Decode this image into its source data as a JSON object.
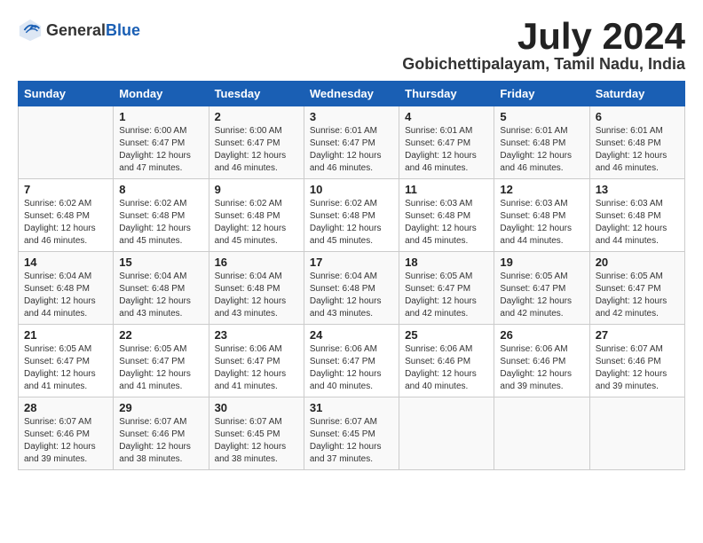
{
  "header": {
    "logo_general": "General",
    "logo_blue": "Blue",
    "month_title": "July 2024",
    "location": "Gobichettipalayam, Tamil Nadu, India"
  },
  "days_of_week": [
    "Sunday",
    "Monday",
    "Tuesday",
    "Wednesday",
    "Thursday",
    "Friday",
    "Saturday"
  ],
  "weeks": [
    [
      {
        "day": "",
        "info": ""
      },
      {
        "day": "1",
        "info": "Sunrise: 6:00 AM\nSunset: 6:47 PM\nDaylight: 12 hours\nand 47 minutes."
      },
      {
        "day": "2",
        "info": "Sunrise: 6:00 AM\nSunset: 6:47 PM\nDaylight: 12 hours\nand 46 minutes."
      },
      {
        "day": "3",
        "info": "Sunrise: 6:01 AM\nSunset: 6:47 PM\nDaylight: 12 hours\nand 46 minutes."
      },
      {
        "day": "4",
        "info": "Sunrise: 6:01 AM\nSunset: 6:47 PM\nDaylight: 12 hours\nand 46 minutes."
      },
      {
        "day": "5",
        "info": "Sunrise: 6:01 AM\nSunset: 6:48 PM\nDaylight: 12 hours\nand 46 minutes."
      },
      {
        "day": "6",
        "info": "Sunrise: 6:01 AM\nSunset: 6:48 PM\nDaylight: 12 hours\nand 46 minutes."
      }
    ],
    [
      {
        "day": "7",
        "info": "Sunrise: 6:02 AM\nSunset: 6:48 PM\nDaylight: 12 hours\nand 46 minutes."
      },
      {
        "day": "8",
        "info": "Sunrise: 6:02 AM\nSunset: 6:48 PM\nDaylight: 12 hours\nand 45 minutes."
      },
      {
        "day": "9",
        "info": "Sunrise: 6:02 AM\nSunset: 6:48 PM\nDaylight: 12 hours\nand 45 minutes."
      },
      {
        "day": "10",
        "info": "Sunrise: 6:02 AM\nSunset: 6:48 PM\nDaylight: 12 hours\nand 45 minutes."
      },
      {
        "day": "11",
        "info": "Sunrise: 6:03 AM\nSunset: 6:48 PM\nDaylight: 12 hours\nand 45 minutes."
      },
      {
        "day": "12",
        "info": "Sunrise: 6:03 AM\nSunset: 6:48 PM\nDaylight: 12 hours\nand 44 minutes."
      },
      {
        "day": "13",
        "info": "Sunrise: 6:03 AM\nSunset: 6:48 PM\nDaylight: 12 hours\nand 44 minutes."
      }
    ],
    [
      {
        "day": "14",
        "info": "Sunrise: 6:04 AM\nSunset: 6:48 PM\nDaylight: 12 hours\nand 44 minutes."
      },
      {
        "day": "15",
        "info": "Sunrise: 6:04 AM\nSunset: 6:48 PM\nDaylight: 12 hours\nand 43 minutes."
      },
      {
        "day": "16",
        "info": "Sunrise: 6:04 AM\nSunset: 6:48 PM\nDaylight: 12 hours\nand 43 minutes."
      },
      {
        "day": "17",
        "info": "Sunrise: 6:04 AM\nSunset: 6:48 PM\nDaylight: 12 hours\nand 43 minutes."
      },
      {
        "day": "18",
        "info": "Sunrise: 6:05 AM\nSunset: 6:47 PM\nDaylight: 12 hours\nand 42 minutes."
      },
      {
        "day": "19",
        "info": "Sunrise: 6:05 AM\nSunset: 6:47 PM\nDaylight: 12 hours\nand 42 minutes."
      },
      {
        "day": "20",
        "info": "Sunrise: 6:05 AM\nSunset: 6:47 PM\nDaylight: 12 hours\nand 42 minutes."
      }
    ],
    [
      {
        "day": "21",
        "info": "Sunrise: 6:05 AM\nSunset: 6:47 PM\nDaylight: 12 hours\nand 41 minutes."
      },
      {
        "day": "22",
        "info": "Sunrise: 6:05 AM\nSunset: 6:47 PM\nDaylight: 12 hours\nand 41 minutes."
      },
      {
        "day": "23",
        "info": "Sunrise: 6:06 AM\nSunset: 6:47 PM\nDaylight: 12 hours\nand 41 minutes."
      },
      {
        "day": "24",
        "info": "Sunrise: 6:06 AM\nSunset: 6:47 PM\nDaylight: 12 hours\nand 40 minutes."
      },
      {
        "day": "25",
        "info": "Sunrise: 6:06 AM\nSunset: 6:46 PM\nDaylight: 12 hours\nand 40 minutes."
      },
      {
        "day": "26",
        "info": "Sunrise: 6:06 AM\nSunset: 6:46 PM\nDaylight: 12 hours\nand 39 minutes."
      },
      {
        "day": "27",
        "info": "Sunrise: 6:07 AM\nSunset: 6:46 PM\nDaylight: 12 hours\nand 39 minutes."
      }
    ],
    [
      {
        "day": "28",
        "info": "Sunrise: 6:07 AM\nSunset: 6:46 PM\nDaylight: 12 hours\nand 39 minutes."
      },
      {
        "day": "29",
        "info": "Sunrise: 6:07 AM\nSunset: 6:46 PM\nDaylight: 12 hours\nand 38 minutes."
      },
      {
        "day": "30",
        "info": "Sunrise: 6:07 AM\nSunset: 6:45 PM\nDaylight: 12 hours\nand 38 minutes."
      },
      {
        "day": "31",
        "info": "Sunrise: 6:07 AM\nSunset: 6:45 PM\nDaylight: 12 hours\nand 37 minutes."
      },
      {
        "day": "",
        "info": ""
      },
      {
        "day": "",
        "info": ""
      },
      {
        "day": "",
        "info": ""
      }
    ]
  ]
}
